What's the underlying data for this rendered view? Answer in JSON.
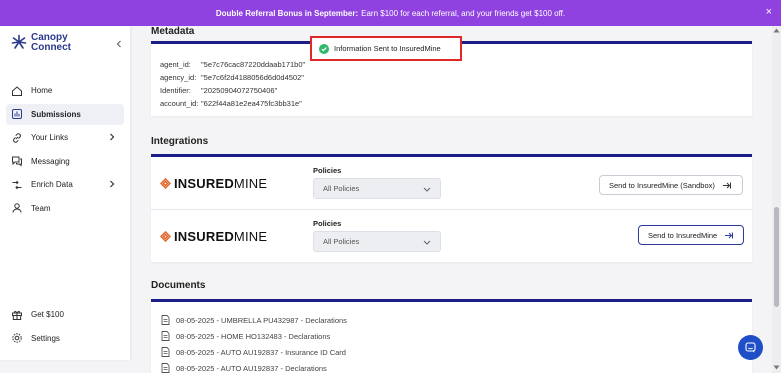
{
  "banner": {
    "bold": "Double Referral Bonus in September:",
    "text": "Earn $100 for each referral, and your friends get $100 off.",
    "close": "×"
  },
  "brand": {
    "line1": "Canopy",
    "line2": "Connect",
    "color": "#2c3a8a"
  },
  "sidebar": {
    "items": [
      {
        "label": "Home",
        "icon": "home-icon"
      },
      {
        "label": "Submissions",
        "icon": "submissions-icon",
        "active": true
      },
      {
        "label": "Your Links",
        "icon": "link-icon"
      },
      {
        "label": "Messaging",
        "icon": "messaging-icon"
      },
      {
        "label": "Enrich Data",
        "icon": "enrich-data-icon"
      },
      {
        "label": "Team",
        "icon": "team-icon"
      }
    ],
    "bottom": [
      {
        "label": "Get $100",
        "icon": "gift-icon"
      },
      {
        "label": "Settings",
        "icon": "gear-icon"
      }
    ]
  },
  "metadata": {
    "title": "Metadata",
    "rows": [
      {
        "key": "agent_id:",
        "value": "\"5e7c76cac87220ddaab171b0\""
      },
      {
        "key": "agency_id:",
        "value": "\"5e7c6f2d4188056d6d0d4502\""
      },
      {
        "key": "Identifier:",
        "value": "\"20250904072750406\""
      },
      {
        "key": "account_id:",
        "value": "\"622f44a81e2ea475fc3bb31e\""
      }
    ]
  },
  "toast": {
    "text": "Information Sent to InsuredMine"
  },
  "integrations": {
    "title": "Integrations",
    "rows": [
      {
        "logo_bold": "INSURED",
        "logo_light": "MINE",
        "policies_label": "Policies",
        "policies_value": "All Policies",
        "button": "Send to InsuredMine (Sandbox)"
      },
      {
        "logo_bold": "INSURED",
        "logo_light": "MINE",
        "policies_label": "Policies",
        "policies_value": "All Policies",
        "button": "Send to InsuredMine"
      }
    ]
  },
  "documents": {
    "title": "Documents",
    "items": [
      "08-05-2025 - UMBRELLA PU432987 - Declarations",
      "08-05-2025 - HOME HO132483 - Declarations",
      "08-05-2025 - AUTO AU192837 - Insurance ID Card",
      "08-05-2025 - AUTO AU192837 - Declarations"
    ]
  },
  "colors": {
    "banner": "#8f42e0",
    "card_border": "#1a1f86",
    "success": "#2fb86b",
    "toast_border": "#e02828",
    "chat": "#1f4fc7",
    "insuredmine_accent": "#e0662a"
  }
}
